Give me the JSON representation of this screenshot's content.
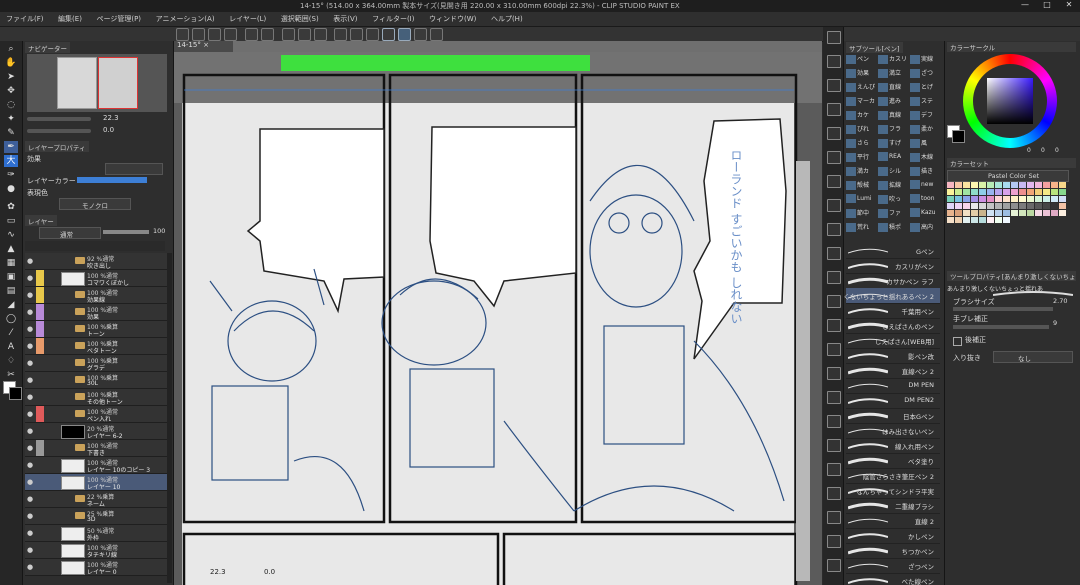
{
  "window": {
    "title": "14-15° (514.00 x 364.00mm 製本サイズ(見開き用 220.00 x 310.00mm 600dpi 22.3%) - CLIP STUDIO PAINT EX",
    "minimize": "—",
    "maximize": "□",
    "close": "✕"
  },
  "menu": [
    "ファイル(F)",
    "編集(E)",
    "ページ管理(P)",
    "アニメーション(A)",
    "レイヤー(L)",
    "選択範囲(S)",
    "表示(V)",
    "フィルター(I)",
    "ウィンドウ(W)",
    "ヘルプ(H)"
  ],
  "navigator": {
    "tab": "ナビゲーター",
    "zoom": "22.3",
    "angle": "0.0"
  },
  "layer_property": {
    "tab": "レイヤープロパティ",
    "effect_label": "効果",
    "layer_color_label": "レイヤーカラー",
    "expression_label": "表現色",
    "expression_value": "モノクロ"
  },
  "layer_panel": {
    "tab": "レイヤー",
    "blend_mode": "通常",
    "opacity": "100",
    "layers": [
      {
        "l1": "92 %通常",
        "l2": "吹き出し",
        "kind": "folder",
        "mark": "",
        "selected": false
      },
      {
        "l1": "100 %通常",
        "l2": "コマワくぼかし",
        "kind": "thumb",
        "mark": "#e8c84a",
        "selected": false
      },
      {
        "l1": "100 %通常",
        "l2": "効果線",
        "kind": "folder",
        "mark": "#e8c84a",
        "selected": false
      },
      {
        "l1": "100 %通常",
        "l2": "効果",
        "kind": "folder",
        "mark": "#b88ad8",
        "selected": false
      },
      {
        "l1": "100 %乗算",
        "l2": "トーン",
        "kind": "folder",
        "mark": "#b88ad8",
        "selected": false
      },
      {
        "l1": "100 %乗算",
        "l2": "ベタトーン",
        "kind": "folder",
        "mark": "#e89a6a",
        "selected": false
      },
      {
        "l1": "100 %乗算",
        "l2": "グラデ",
        "kind": "folder",
        "mark": "",
        "selected": false
      },
      {
        "l1": "100 %乗算",
        "l2": "30L",
        "kind": "folder",
        "mark": "",
        "selected": false
      },
      {
        "l1": "100 %乗算",
        "l2": "その他トーン",
        "kind": "folder",
        "mark": "",
        "selected": false
      },
      {
        "l1": "100 %通常",
        "l2": "ペン入れ",
        "kind": "folder",
        "mark": "#e05a5a",
        "selected": false
      },
      {
        "l1": "20 %通常",
        "l2": "レイヤー 6-2",
        "kind": "thumbdark",
        "mark": "",
        "selected": false
      },
      {
        "l1": "100 %通常",
        "l2": "下書き",
        "kind": "folder",
        "mark": "#999999",
        "selected": false
      },
      {
        "l1": "100 %通常",
        "l2": "レイヤー 10のコピー 3",
        "kind": "thumb",
        "mark": "",
        "selected": false
      },
      {
        "l1": "100 %通常",
        "l2": "レイヤー 10",
        "kind": "thumb",
        "mark": "",
        "selected": true
      },
      {
        "l1": "22 %乗算",
        "l2": "ネーム",
        "kind": "folder",
        "mark": "",
        "selected": false
      },
      {
        "l1": "25 %乗算",
        "l2": "3D",
        "kind": "folder",
        "mark": "",
        "selected": false
      },
      {
        "l1": "50 %通常",
        "l2": "外枠",
        "kind": "thumb",
        "mark": "",
        "selected": false
      },
      {
        "l1": "100 %通常",
        "l2": "タチキリ線",
        "kind": "thumb",
        "mark": "",
        "selected": false
      },
      {
        "l1": "100 %通常",
        "l2": "レイヤー 0",
        "kind": "thumb",
        "mark": "",
        "selected": false
      }
    ]
  },
  "canvas": {
    "tab": "14-15°",
    "zoom": "22.3",
    "angle": "0.0",
    "speech_text": "ローランド すごいかも しれない"
  },
  "sub_tool": {
    "tab": "サブツール[ペン]",
    "tools": [
      "ペン",
      "カスリ",
      "実線",
      "効果",
      "満立",
      "ざつ",
      "えんぴ",
      "直線",
      "とげ",
      "マーカ",
      "進み",
      "ステ",
      "カケ",
      "真線",
      "デフ",
      "ぴれ",
      "フラ",
      "柔か",
      "さら",
      "すげ",
      "風",
      "平行",
      "REA",
      "木線",
      "満カ",
      "シル",
      "描き",
      "殻械",
      "拡線",
      "new",
      "Lumi",
      "吹っ",
      "toon",
      "節中",
      "ファ",
      "Kazu",
      "荒れ",
      "積ポ",
      "高内"
    ]
  },
  "brushes": [
    "Gペン",
    "カスリがペン",
    "カサかペン ラフ",
    "あんまり激しくないちょっと揺れあるペン 2",
    "千葉用ペン",
    "しえぱさんのペン",
    "しえぱさん[WEB用]",
    "影ペン改",
    "直線ペン 2",
    "DM PEN",
    "DM PEN2",
    "日本Gペン",
    "はみ出さないペン",
    "線入れ用ペン",
    "ベタ塗り",
    "陰管さらさき筆圧ペン 2",
    "なんちゃってシンドラ平実",
    "二重線ブラシ",
    "直線 2",
    "かしペン",
    "ちつかペン",
    "ざつペン",
    "べた線ペン"
  ],
  "color_wheel": {
    "tab": "カラーサークル",
    "h": "0",
    "s": "0",
    "v": "0"
  },
  "color_set": {
    "tab": "カラーセット",
    "name": "Pastel Color Set",
    "colors": [
      "#f7b6c2",
      "#f9c6a6",
      "#fbe3a1",
      "#fdf7b0",
      "#d9f2a8",
      "#b6ecb5",
      "#a7e6d7",
      "#a8dcef",
      "#b3c7f2",
      "#c8b8f2",
      "#e3b7ef",
      "#f3b6dc",
      "#f5a0a0",
      "#f7b48a",
      "#f8d88a",
      "#fbf29a",
      "#c9ec90",
      "#9fe4a2",
      "#8fdcc8",
      "#8fcfe8",
      "#98b4ee",
      "#b6a4ee",
      "#d8a2ea",
      "#eea2cf",
      "#ee8f8f",
      "#f1a477",
      "#f2cd77",
      "#f5ea86",
      "#b8e37d",
      "#88d88e",
      "#78d0b8",
      "#78c2e0",
      "#8aa4e8",
      "#a592e6",
      "#cc8fe0",
      "#e490c4",
      "#ffd6d6",
      "#ffe3cc",
      "#fff1c6",
      "#fffbd0",
      "#eaf8cf",
      "#d5f4d6",
      "#cdf1e8",
      "#cfeaf6",
      "#d3def8",
      "#e0d6f8",
      "#efd6f6",
      "#f8d6ec",
      "#e8e8e8",
      "#d6d6d6",
      "#c4c4c4",
      "#b2b2b2",
      "#a0a0a0",
      "#8e8e8e",
      "#7c7c7c",
      "#6a6a6a",
      "#585858",
      "#464646",
      "#343434",
      "#f4c4a8",
      "#e8b48e",
      "#d8a07a",
      "#f1e0c4",
      "#e2cda8",
      "#c9b48c",
      "#cfe3f4",
      "#b6d0ec",
      "#9cbde2",
      "#e6f2d6",
      "#d2e6bc",
      "#bcd8a2",
      "#f6d9e6",
      "#ecc2d6",
      "#e0aac4",
      "#fcefe0",
      "#f6e0c8",
      "#eed0b0",
      "#e2f0f0",
      "#cce6e6",
      "#b6dcdc",
      "#fff0f5",
      "#f0fff0",
      "#f0f8ff"
    ]
  },
  "tool_property": {
    "tab": "ツールプロパティ[あんまり激しくないちょっと揺れあるペン 2]",
    "brush_name": "あんまり激しくないちょっと揺れあるペン 2",
    "brush_size_label": "ブラシサイズ",
    "brush_size_value": "2.70",
    "stabilize_label": "手ブレ補正",
    "stabilize_value": "9",
    "post_label": "後補正",
    "taper_label": "入り抜き",
    "taper_value": "なし"
  },
  "colors": {
    "accent_green": "#3ee03e",
    "selected_layer": "#4a5a78",
    "line_blue": "#2c4f82"
  }
}
